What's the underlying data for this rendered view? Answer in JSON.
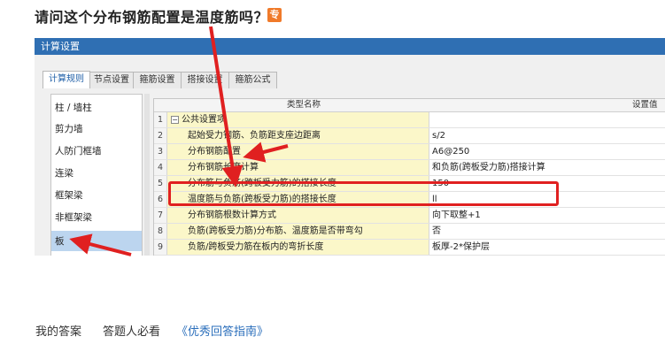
{
  "question": {
    "title": "请问这个分布钢筋配置是温度筋吗？",
    "badge": "专"
  },
  "dialog": {
    "title": "计算设置",
    "tabs": [
      "计算规则",
      "节点设置",
      "箍筋设置",
      "搭接设置",
      "箍筋公式"
    ],
    "active_tab": "计算规则",
    "sidebar": [
      "柱 / 墙柱",
      "剪力墙",
      "人防门框墙",
      "连梁",
      "框架梁",
      "非框架梁",
      "板"
    ],
    "active_sidebar": "板",
    "grid": {
      "headers": [
        "类型名称",
        "设置值"
      ],
      "rows": [
        {
          "num": "1",
          "name": "公共设置项",
          "value": ""
        },
        {
          "num": "2",
          "name": "起始受力钢筋、负筋距支座边距离",
          "value": "s/2"
        },
        {
          "num": "3",
          "name": "分布钢筋配置",
          "value": "A6@250"
        },
        {
          "num": "4",
          "name": "分布钢筋长度计算",
          "value": "和负筋(跨板受力筋)搭接计算"
        },
        {
          "num": "5",
          "name": "分布筋与负筋(跨板受力筋)的搭接长度",
          "value": "150"
        },
        {
          "num": "6",
          "name": "温度筋与负筋(跨板受力筋)的搭接长度",
          "value": "ll"
        },
        {
          "num": "7",
          "name": "分布钢筋根数计算方式",
          "value": "向下取整+1"
        },
        {
          "num": "8",
          "name": "负筋(跨板受力筋)分布筋、温度筋是否带弯勾",
          "value": "否"
        },
        {
          "num": "9",
          "name": "负筋/跨板受力筋在板内的弯折长度",
          "value": "板厚-2*保护层"
        }
      ]
    }
  },
  "footer": {
    "my_answer": "我的答案",
    "must_read": "答题人必看",
    "guide": "《优秀回答指南》"
  },
  "colors": {
    "accent": "#2f6fb3",
    "annotation": "#e02020",
    "name_cell": "#fbf7c9"
  }
}
